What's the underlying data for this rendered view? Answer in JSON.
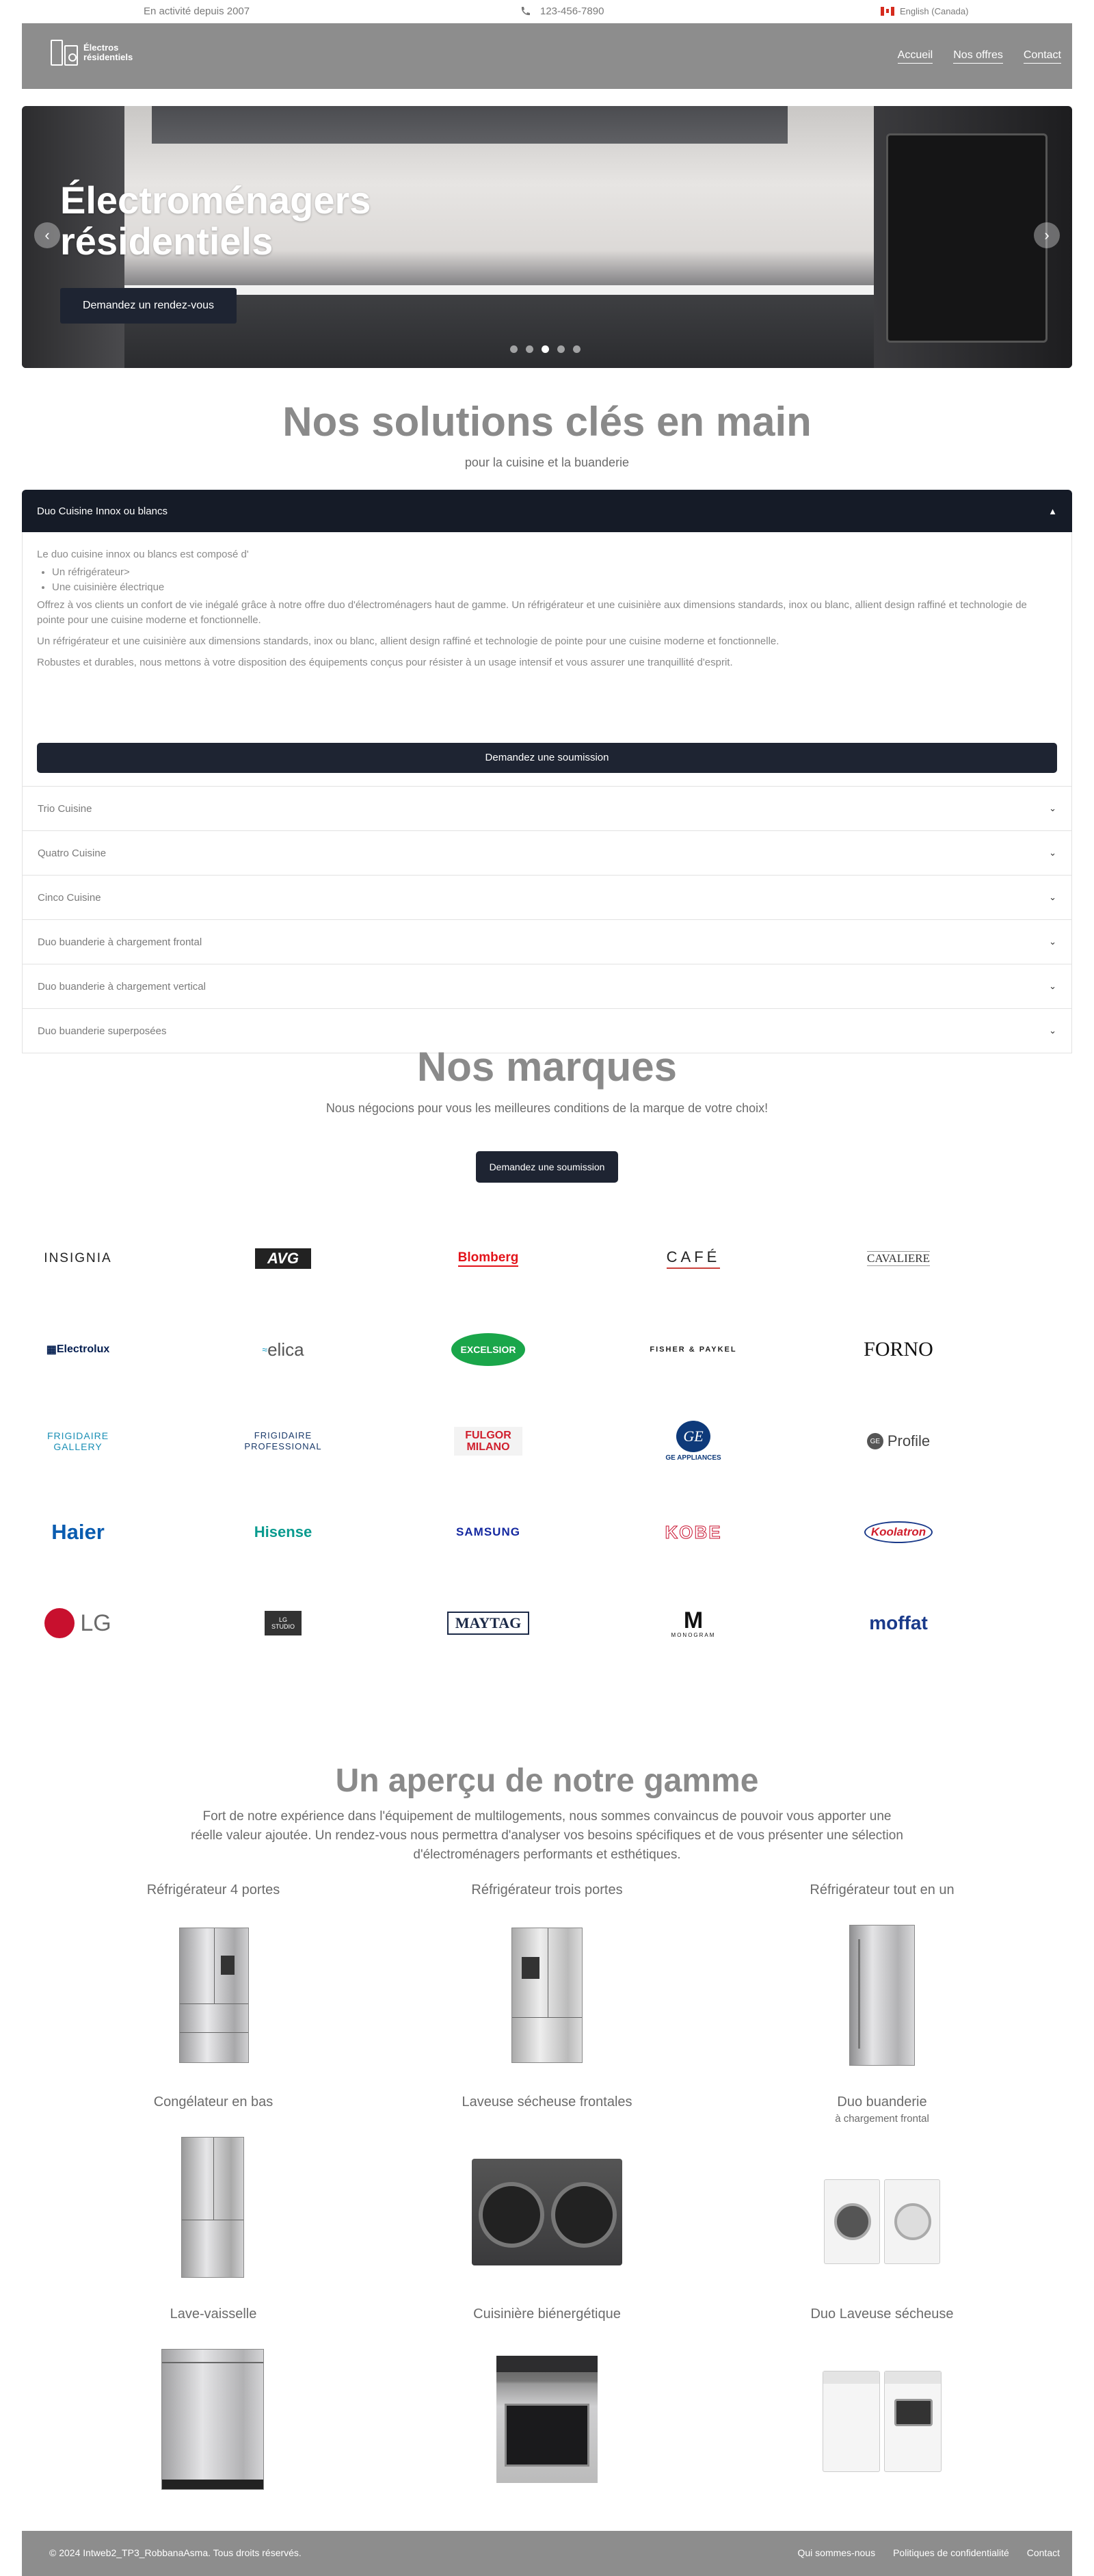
{
  "topbar": {
    "since": "En activité depuis 2007",
    "phone": "123-456-7890",
    "language": "English (Canada)"
  },
  "header": {
    "logo_line1": "Électros",
    "logo_line2": "résidentiels",
    "nav": [
      "Accueil",
      "Nos offres",
      "Contact"
    ]
  },
  "hero": {
    "title_line1": "Électroménagers",
    "title_line2": "résidentiels",
    "cta": "Demandez un rendez-vous",
    "prev": "‹",
    "next": "›"
  },
  "solutions": {
    "title": "Nos solutions clés en main",
    "subtitle": "pour la cuisine et la buanderie",
    "open_item": {
      "label": "Duo Cuisine Innox ou blancs",
      "intro": "Le duo cuisine innox ou blancs est composé d'",
      "list": [
        "Un réfrigérateur>",
        "Une cuisinière électrique"
      ],
      "p1": "Offrez à vos clients un confort de vie inégalé grâce à notre offre duo d'électroménagers haut de gamme. Un réfrigérateur et une cuisinière aux dimensions standards, inox ou blanc, allient design raffiné et technologie de pointe pour une cuisine moderne et fonctionnelle.",
      "p2": "Un réfrigérateur et une cuisinière aux dimensions standards, inox ou blanc, allient design raffiné et technologie de pointe pour une cuisine moderne et fonctionnelle.",
      "p3": "Robustes et durables, nous mettons à votre disposition des équipements conçus pour résister à un usage intensif et vous assurer une tranquillité d'esprit.",
      "cta": "Demandez une soumission"
    },
    "items": [
      "Trio Cuisine",
      "Quatro Cuisine",
      "Cinco Cuisine",
      "Duo buanderie à chargement frontal",
      "Duo buanderie à chargement vertical",
      "Duo buanderie superposées"
    ]
  },
  "brands": {
    "title": "Nos marques",
    "subtitle": "Nous négocions pour vous les meilleures conditions de la marque de votre choix!",
    "cta": "Demandez une soumission",
    "list": [
      "INSIGNIA",
      "AVG",
      "Blomberg",
      "CAFÉ",
      "CAVALIERE",
      "Electrolux",
      "elica",
      "EXCELSIOR",
      "FISHER & PAYKEL",
      "FORNO",
      "FRIGIDAIRE GALLERY",
      "FRIGIDAIRE PROFESSIONAL",
      "FULGOR MILANO",
      "GE APPLIANCES",
      "Profile",
      "Haier",
      "Hisense",
      "SAMSUNG",
      "KOBE",
      "Koolatron",
      "LG",
      "LG STUDIO",
      "MAYTAG",
      "MONOGRAM",
      "moffat"
    ]
  },
  "range": {
    "title": "Un aperçu de notre gamme",
    "intro": "Fort de notre expérience dans l'équipement de multilogements, nous sommes convaincus de pouvoir vous apporter une réelle valeur ajoutée. Un rendez-vous nous permettra d'analyser vos besoins spécifiques et de vous présenter une sélection d'électroménagers performants et esthétiques.",
    "products": [
      {
        "name": "Réfrigérateur 4 portes",
        "sub": ""
      },
      {
        "name": "Réfrigérateur trois portes",
        "sub": ""
      },
      {
        "name": "Réfrigérateur tout en un",
        "sub": ""
      },
      {
        "name": "Congélateur en bas",
        "sub": ""
      },
      {
        "name": "Laveuse sécheuse frontales",
        "sub": ""
      },
      {
        "name": "Duo buanderie",
        "sub": "à chargement frontal"
      },
      {
        "name": "Lave-vaisselle",
        "sub": ""
      },
      {
        "name": "Cuisinière biénergétique",
        "sub": ""
      },
      {
        "name": "Duo Laveuse sécheuse",
        "sub": ""
      }
    ]
  },
  "footer": {
    "copyright": "© 2024 Intweb2_TP3_RobbanaAsma. Tous droits réservés.",
    "links": [
      "Qui sommes-nous",
      "Politiques de confidentialité",
      "Contact"
    ]
  },
  "colors": {
    "dark": "#1e2432",
    "header": "#8d8d8d",
    "title": "#8a8a8a"
  }
}
